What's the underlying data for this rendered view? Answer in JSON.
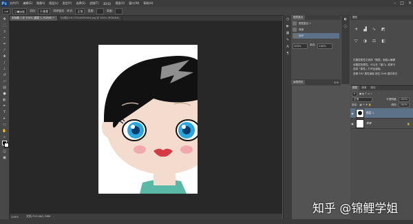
{
  "app": {
    "logo": "Ps"
  },
  "menu": [
    "文件(F)",
    "编辑(E)",
    "图像(I)",
    "图层(L)",
    "类型(Y)",
    "选择(S)",
    "滤镜(T)",
    "3D(D)",
    "视图(V)",
    "窗口(W)",
    "帮助(H)"
  ],
  "window_controls": [
    "–",
    "□",
    "×"
  ],
  "options_bar": {
    "feather_label": "羽化:",
    "feather_value": "0 像素",
    "antialias_label": "消除锯齿",
    "style_label": "样式:",
    "style_value": "正常",
    "width_label": "宽度:",
    "height_label": "高度:"
  },
  "doc_tabs": [
    {
      "label": "未标题-1 @ 100% (图层 1, RGB/8) *",
      "active": true
    },
    {
      "label": "QQ图片20170318092604.jpg @ 100% (RGB/8#)",
      "active": false
    }
  ],
  "tools": [
    "move-icon",
    "marquee-icon",
    "lasso-icon",
    "quick-select-icon",
    "crop-icon",
    "eyedropper-icon",
    "healing-icon",
    "brush-icon",
    "stamp-icon",
    "history-brush-icon",
    "eraser-icon",
    "gradient-icon",
    "blur-icon",
    "dodge-icon",
    "pen-icon",
    "type-icon",
    "path-select-icon",
    "shape-icon",
    "hand-icon",
    "zoom-icon"
  ],
  "status": {
    "zoom": "100%",
    "doc": "文档:703.4K/1.38M"
  },
  "layer_comps": {
    "tab": "图层复合",
    "items": [
      "图层复合 1",
      "背景",
      "制作"
    ],
    "opacity_value": "100%",
    "fill_value": "100%",
    "fill_label": "填充:"
  },
  "mid_panel": {
    "label": "画笔预设",
    "value": "200"
  },
  "properties": {
    "tab": "属性",
    "lines": [
      "在图层属性中选择「图层」面板以编辑",
      "该图层的属性。可以在「窗口」菜单中",
      "选择「属性」打开此面板。",
      "查看 SHF 属性面板 按住 Shift 键并单击"
    ]
  },
  "layers_panel": {
    "tabs": [
      "图层",
      "通道",
      "路径"
    ],
    "blend_mode": "正常",
    "opacity_label": "不透明度:",
    "opacity": "100%",
    "lock_label": "锁定:",
    "fill_label": "填充:",
    "fill": "100%",
    "layers": [
      {
        "name": "图层 1",
        "selected": true
      },
      {
        "name": "背景",
        "selected": false
      }
    ]
  },
  "watermark": "知乎 @锦鲤学姐",
  "colors": {
    "face": "#f3dccd",
    "hair": "#111111",
    "iris": "#2aa7de",
    "lips": "#d43b45",
    "cheek": "#f2a9ae",
    "collar": "#5ab9a6",
    "clip": "#8f8f8f"
  }
}
